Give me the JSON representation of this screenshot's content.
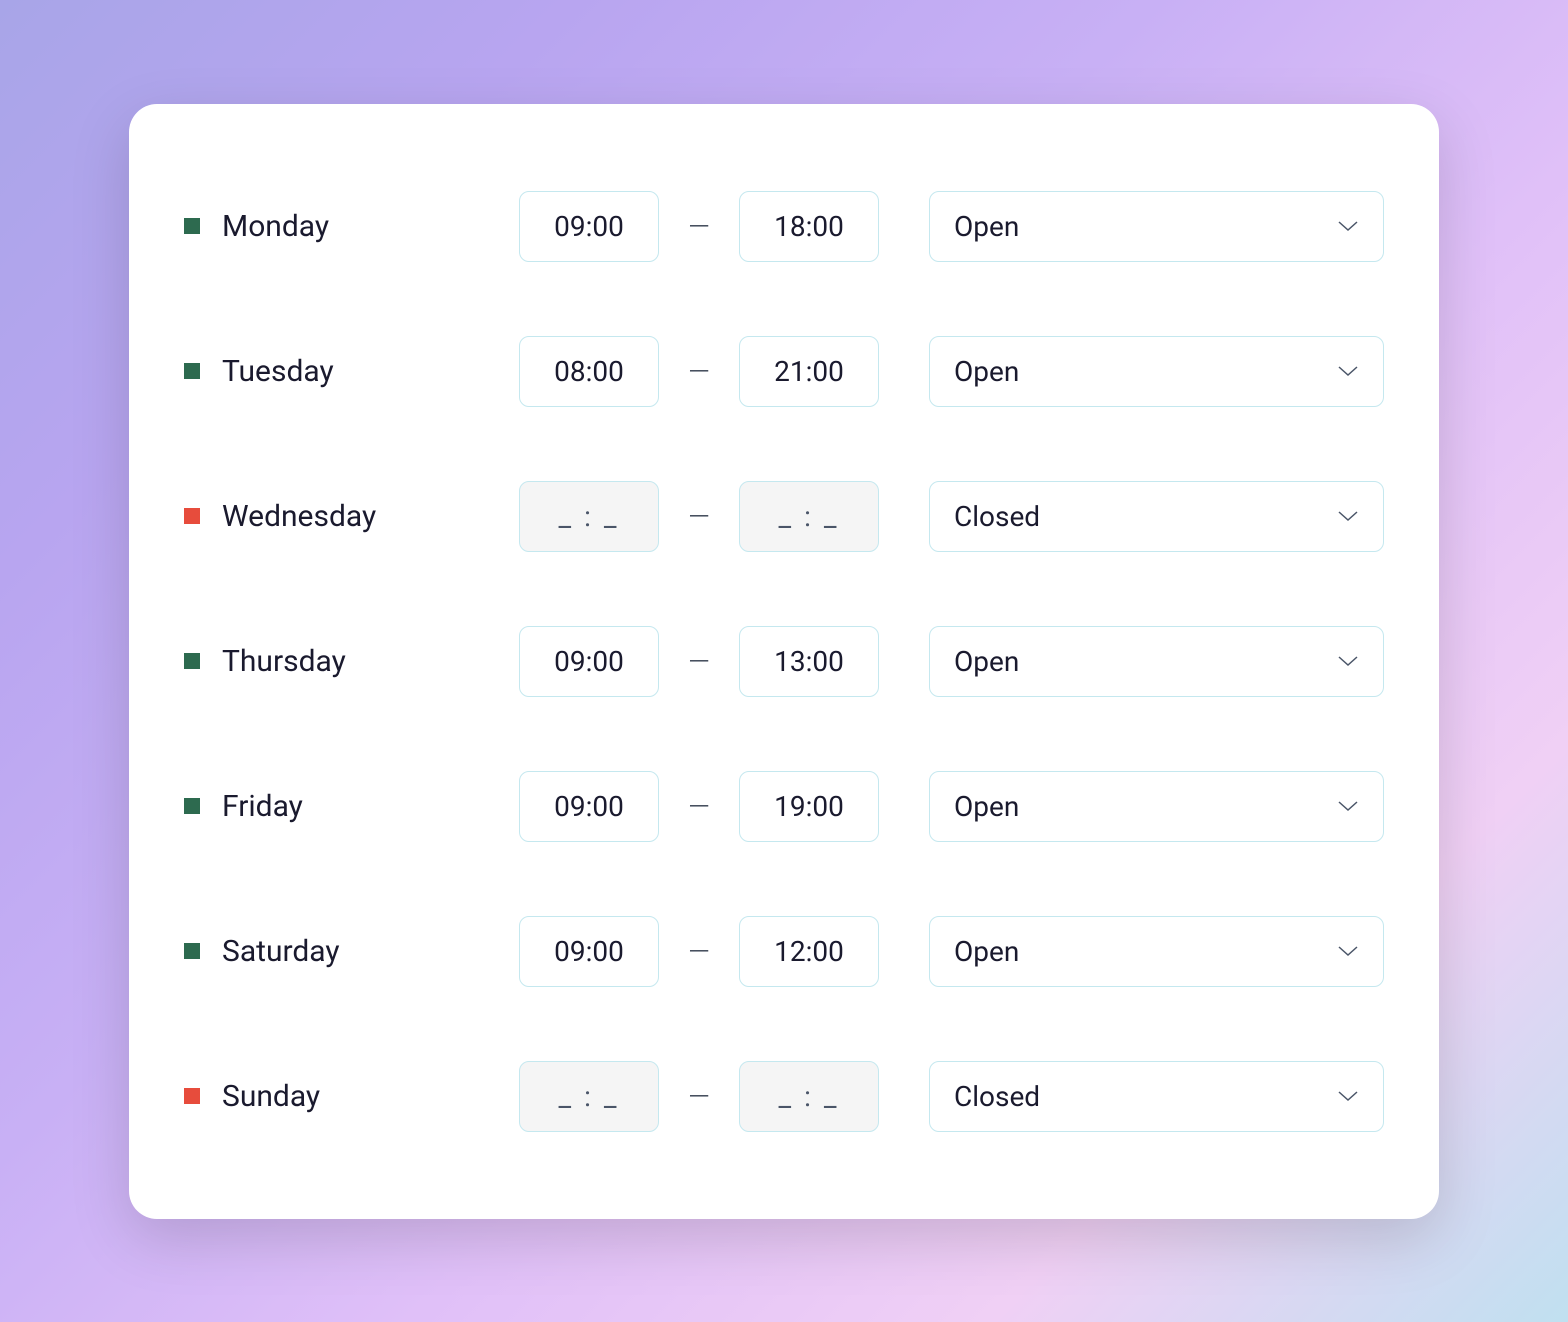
{
  "schedule": [
    {
      "day": "Monday",
      "status": "open",
      "start": "09:00",
      "end": "18:00",
      "statusLabel": "Open"
    },
    {
      "day": "Tuesday",
      "status": "open",
      "start": "08:00",
      "end": "21:00",
      "statusLabel": "Open"
    },
    {
      "day": "Wednesday",
      "status": "closed",
      "start": "_ : _",
      "end": "_ : _",
      "statusLabel": "Closed"
    },
    {
      "day": "Thursday",
      "status": "open",
      "start": "09:00",
      "end": "13:00",
      "statusLabel": "Open"
    },
    {
      "day": "Friday",
      "status": "open",
      "start": "09:00",
      "end": "19:00",
      "statusLabel": "Open"
    },
    {
      "day": "Saturday",
      "status": "open",
      "start": "09:00",
      "end": "12:00",
      "statusLabel": "Open"
    },
    {
      "day": "Sunday",
      "status": "closed",
      "start": "_ : _",
      "end": "_ : _",
      "statusLabel": "Closed"
    }
  ],
  "separator": "—"
}
